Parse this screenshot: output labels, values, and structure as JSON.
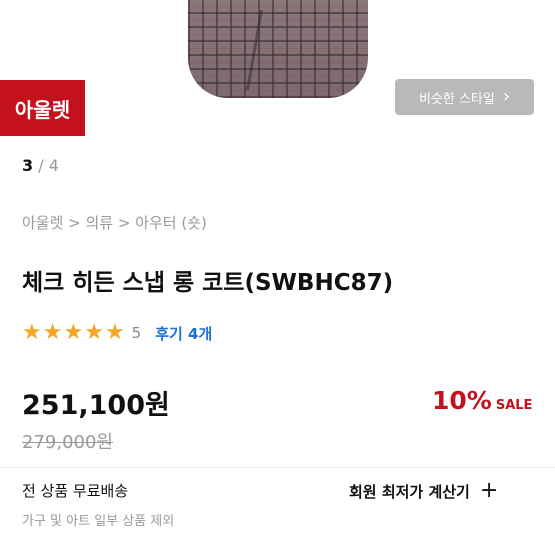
{
  "image_area": {
    "outlet_badge": "아울렛",
    "similar_style_button": "비슷한 스타일"
  },
  "pager": {
    "current": "3",
    "total": "/ 4"
  },
  "breadcrumb": "아울렛 > 의류 > 아우터 (숏)",
  "product": {
    "title": "체크 히든 스냅 롱 코트(SWBHC87)",
    "rating": {
      "stars": 5,
      "value": "5",
      "reviews_label": "후기 4개"
    },
    "price": "251,100원",
    "original_price": "279,000원",
    "discount_percent": "10%",
    "sale_label": "SALE"
  },
  "shipping": {
    "title": "전 상품 무료배송",
    "note": "가구 및 아트 일부 상품 제외",
    "calculator_label": "회원 최저가 계산기",
    "calculator_icon": "plus-icon"
  },
  "colors": {
    "accent_red": "#c3121d",
    "link_blue": "#1e6fd9",
    "star": "#f5a623"
  }
}
